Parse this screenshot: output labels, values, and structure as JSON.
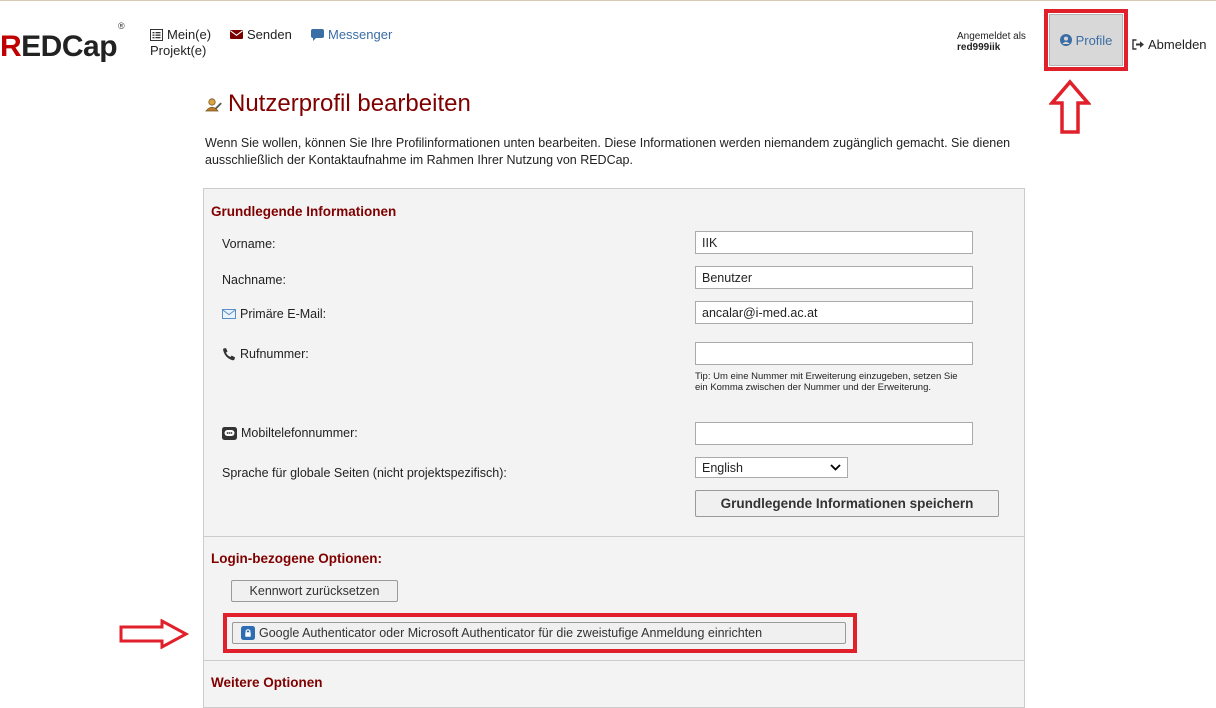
{
  "app": {
    "logo_text": "REDCap",
    "logo_mark": "®"
  },
  "nav": {
    "projects_line1": "Mein(e)",
    "projects_line2": "Projekt(e)",
    "send": "Senden",
    "messenger": "Messenger"
  },
  "user": {
    "logged_in_label": "Angemeldet als",
    "username": "red999iik",
    "profile_label": "Profile",
    "logout_label": "Abmelden"
  },
  "page": {
    "title": "Nutzerprofil bearbeiten",
    "intro": "Wenn Sie wollen, können Sie Ihre Profilinformationen unten bearbeiten. Diese Informationen werden niemandem zugänglich gemacht. Sie dienen ausschließlich der Kontaktaufnahme im Rahmen Ihrer Nutzung von REDCap."
  },
  "basic": {
    "title": "Grundlegende Informationen",
    "first_name_label": "Vorname:",
    "first_name_value": "IIK",
    "last_name_label": "Nachname:",
    "last_name_value": "Benutzer",
    "email_label": "Primäre E-Mail:",
    "email_value": "ancalar@i-med.ac.at",
    "phone_label": "Rufnummer:",
    "phone_value": "",
    "phone_tip": "Tip: Um eine Nummer mit Erweiterung einzugeben, setzen Sie ein Komma zwischen der Nummer und der Erweiterung.",
    "mobile_label": "Mobiltelefonnummer:",
    "mobile_value": "",
    "language_label": "Sprache für globale Seiten (nicht projektspezifisch):",
    "language_value": "English",
    "save_label": "Grundlegende Informationen speichern"
  },
  "login": {
    "title": "Login-bezogene Optionen:",
    "reset_password_label": "Kennwort zurücksetzen",
    "two_factor_label": "Google Authenticator oder Microsoft Authenticator für die zweistufige Anmeldung einrichten"
  },
  "further": {
    "title": "Weitere Optionen"
  },
  "colors": {
    "brand_red": "#c00000",
    "heading_maroon": "#800000",
    "highlight_red": "#e0202a",
    "link_blue": "#3a6ea5"
  }
}
